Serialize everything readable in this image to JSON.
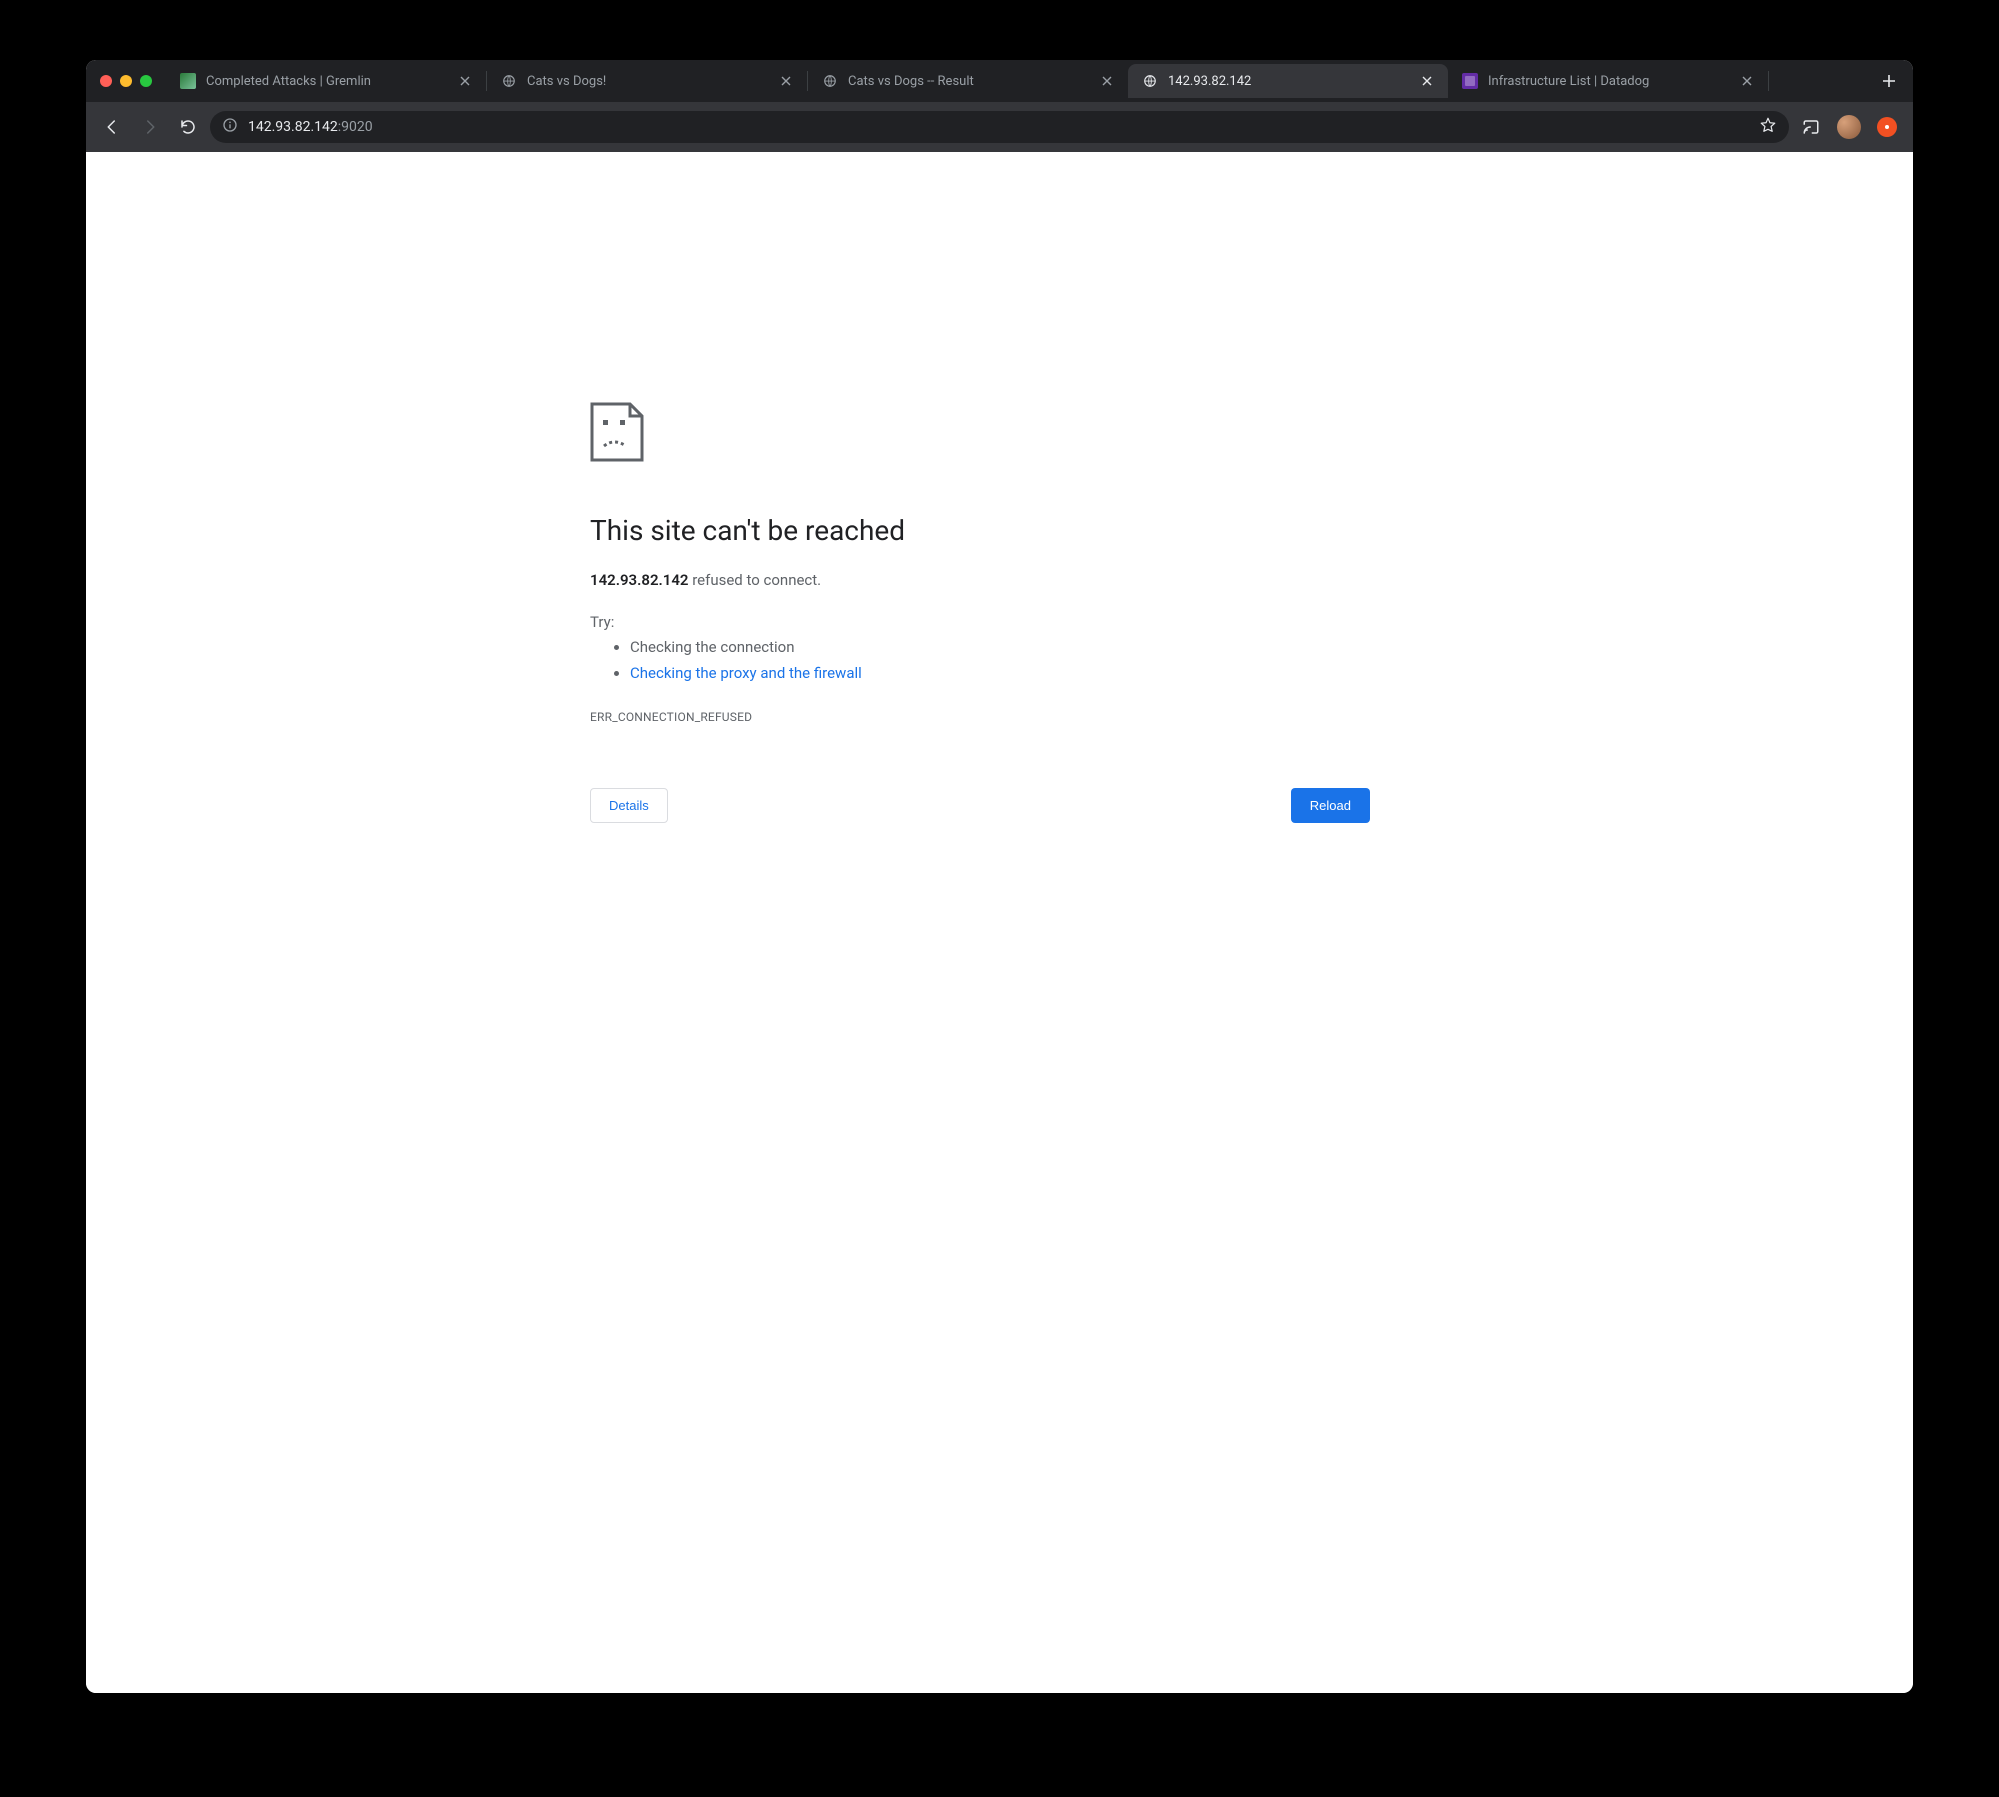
{
  "tabs": [
    {
      "title": "Completed Attacks | Gremlin",
      "active": false,
      "favicon": "gremlin"
    },
    {
      "title": "Cats vs Dogs!",
      "active": false,
      "favicon": "globe"
    },
    {
      "title": "Cats vs Dogs -- Result",
      "active": false,
      "favicon": "globe"
    },
    {
      "title": "142.93.82.142",
      "active": true,
      "favicon": "globe"
    },
    {
      "title": "Infrastructure List | Datadog",
      "active": false,
      "favicon": "datadog"
    }
  ],
  "address": {
    "host": "142.93.82.142",
    "port": ":9020"
  },
  "error": {
    "title": "This site can't be reached",
    "host": "142.93.82.142",
    "message_suffix": " refused to connect.",
    "try_label": "Try:",
    "suggestions": [
      {
        "text": "Checking the connection",
        "link": false
      },
      {
        "text": "Checking the proxy and the firewall",
        "link": true
      }
    ],
    "code": "ERR_CONNECTION_REFUSED",
    "details_label": "Details",
    "reload_label": "Reload"
  }
}
